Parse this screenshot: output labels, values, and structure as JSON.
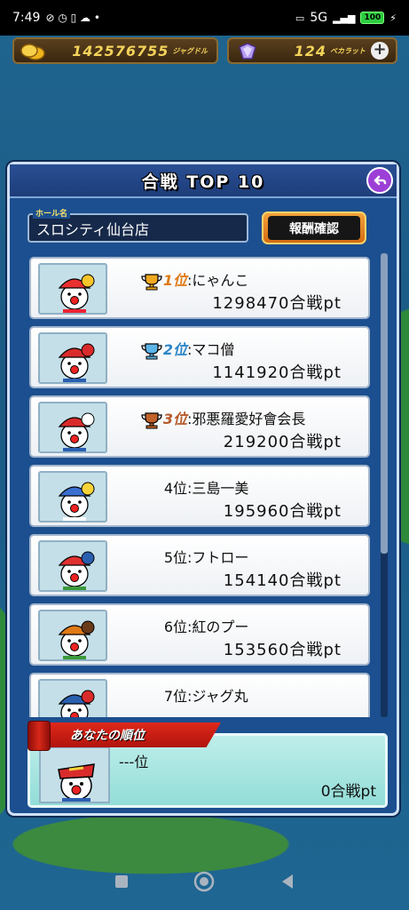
{
  "status_bar": {
    "time": "7:49",
    "network": "5G",
    "battery": "100"
  },
  "currency": {
    "jag_amount": "142576755",
    "jag_unit": "ジャグドル",
    "carat_amount": "124",
    "carat_unit": "ベカラット"
  },
  "panel": {
    "title": "合戦 TOP 10",
    "hall_label": "ホール名",
    "hall_name": "スロシティ仙台店",
    "reward_button": "報酬確認"
  },
  "rankings": [
    {
      "rank": "1位",
      "name": ":にゃんこ",
      "score": "1298470合戦pt",
      "trophy": "gold"
    },
    {
      "rank": "2位",
      "name": ":マコ僧",
      "score": "1141920合戦pt",
      "trophy": "silver"
    },
    {
      "rank": "3位",
      "name": ":邪悪羅愛好會会長",
      "score": "219200合戦pt",
      "trophy": "bronze"
    },
    {
      "rank": "4位",
      "name": ":三島一美",
      "score": "195960合戦pt"
    },
    {
      "rank": "5位",
      "name": ":フトロー",
      "score": "154140合戦pt"
    },
    {
      "rank": "6位",
      "name": ":紅のプー",
      "score": "153560合戦pt"
    },
    {
      "rank": "7位",
      "name": ":ジャグ丸",
      "score": ""
    }
  ],
  "my_rank": {
    "label": "あなたの順位",
    "position": "---位",
    "score": "0合戦pt"
  },
  "colors": {
    "panel_bg": "#1c4f8f",
    "row_bg": "#ffffff",
    "my_rank_bg": "#a8e4e0",
    "ribbon": "#d0201a",
    "gold": "#e07a16"
  }
}
